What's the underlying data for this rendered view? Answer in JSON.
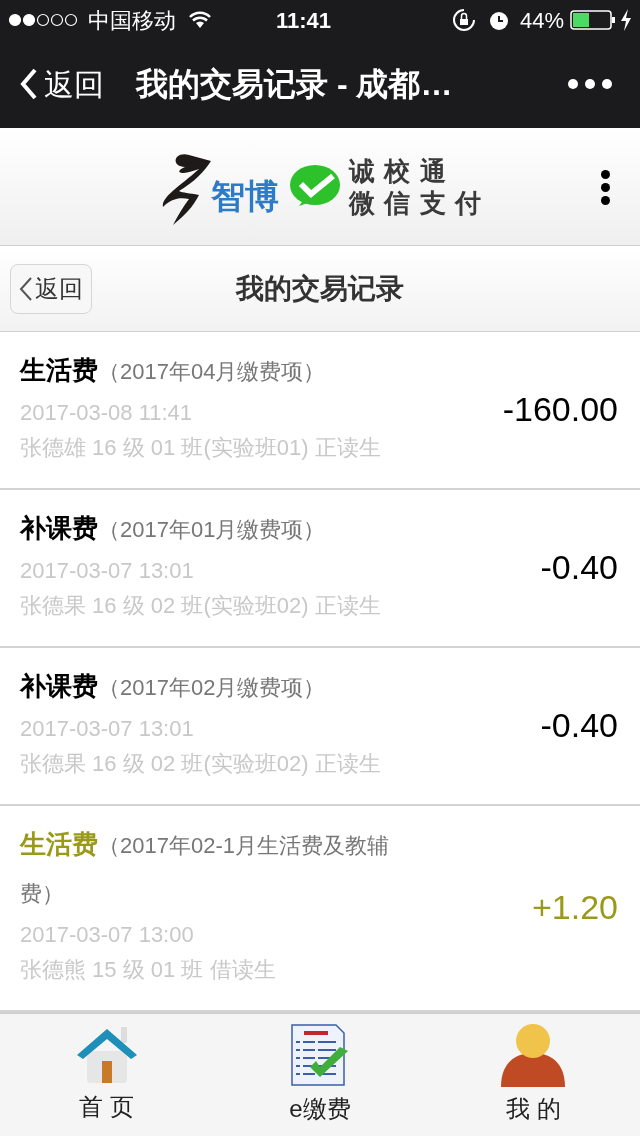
{
  "status_bar": {
    "carrier": "中国移动",
    "time": "11:41",
    "battery": "44%"
  },
  "nav_bar": {
    "back": "返回",
    "title": "我的交易记录 - 成都…"
  },
  "logo": {
    "brand": "智博",
    "line_1": "诚 校 通",
    "line_2": "微 信 支 付"
  },
  "header": {
    "back": "返回",
    "title": "我的交易记录"
  },
  "records": [
    {
      "kind": "expense",
      "name": "生活费",
      "note": "（2017年04月缴费项）",
      "time": "2017-03-08 11:41",
      "student": "张德雄 16 级 01 班(实验班01) 正读生",
      "amount": "-160.00"
    },
    {
      "kind": "expense",
      "name": "补课费",
      "note": "（2017年01月缴费项）",
      "time": "2017-03-07 13:01",
      "student": "张德果 16 级 02 班(实验班02) 正读生",
      "amount": "-0.40"
    },
    {
      "kind": "expense",
      "name": "补课费",
      "note": "（2017年02月缴费项）",
      "time": "2017-03-07 13:01",
      "student": "张德果 16 级 02 班(实验班02) 正读生",
      "amount": "-0.40"
    },
    {
      "kind": "income",
      "name": "生活费",
      "note": "（2017年02-1月生活费及教辅费）",
      "time": "2017-03-07 13:00",
      "student": "张德熊 15 级 01 班 借读生",
      "amount": "+1.20"
    }
  ],
  "tab_bar": [
    {
      "kind": "home",
      "label": "首 页"
    },
    {
      "kind": "bill",
      "label": "e缴费"
    },
    {
      "kind": "person",
      "label": "我 的"
    }
  ]
}
